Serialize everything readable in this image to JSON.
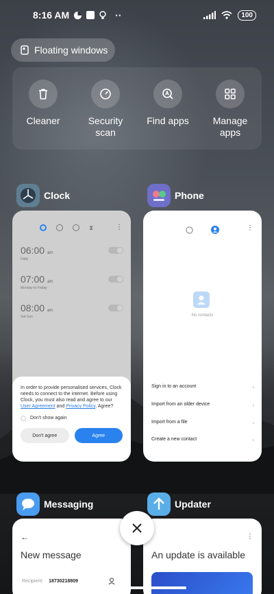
{
  "status_bar": {
    "time": "8:16 AM",
    "overflow": "··",
    "battery": "100"
  },
  "floating_windows": {
    "label": "Floating windows"
  },
  "tools": [
    {
      "label": "Cleaner",
      "icon": "trash-icon"
    },
    {
      "label": "Security scan",
      "icon": "speedometer-icon"
    },
    {
      "label": "Find apps",
      "icon": "search-letter-a-icon"
    },
    {
      "label": "Manage apps",
      "icon": "grid-icon"
    }
  ],
  "apps": {
    "clock": {
      "name": "Clock",
      "alarms": [
        {
          "time": "06:00",
          "suffix": "am",
          "sub": "Daily"
        },
        {
          "time": "07:00",
          "suffix": "am",
          "sub": "Monday to Friday"
        },
        {
          "time": "08:00",
          "suffix": "am",
          "sub": "Sat-Sun"
        }
      ],
      "dialog": {
        "text_before": "In order to provide personalised services, Clock needs to connect to the internet. Before using Clock, you must also read and agree to our",
        "link_user": "User Agreement",
        "and": "and",
        "link_privacy": "Privacy Policy",
        "text_after": ". Agree?",
        "checkbox": "Don't show again",
        "btn_decline": "Don't agree",
        "btn_agree": "Agree"
      }
    },
    "phone": {
      "name": "Phone",
      "no_contacts": "No contacts",
      "menu": [
        "Sign in to an account",
        "Import from an older device",
        "Import from a file",
        "Create a new contact"
      ]
    },
    "messaging": {
      "name": "Messaging",
      "title": "New message",
      "recipient_label": "Recipient:",
      "recipient_value": "18730218809"
    },
    "updater": {
      "name": "Updater",
      "title": "An update is available"
    }
  },
  "colors": {
    "accent": "#2a82ee",
    "card": "#ffffff"
  }
}
